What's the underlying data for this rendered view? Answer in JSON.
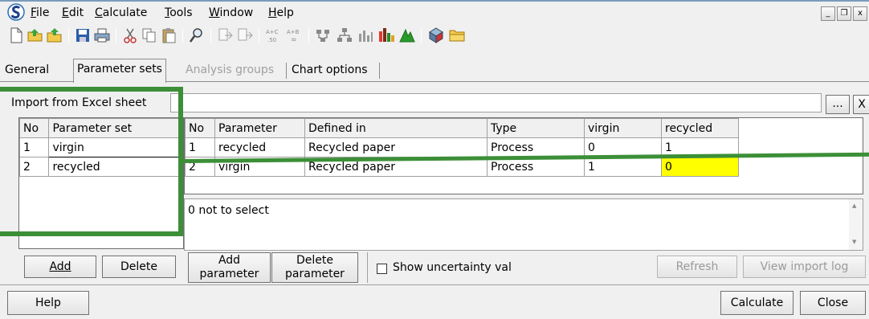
{
  "menu": {
    "file": "File",
    "edit": "Edit",
    "calculate": "Calculate",
    "tools": "Tools",
    "window": "Window",
    "help": "Help"
  },
  "mdi": {
    "minimize": "_",
    "restore": "❐",
    "close": "x"
  },
  "tabs": [
    {
      "label": "General"
    },
    {
      "label": "Parameter sets"
    },
    {
      "label": "Analysis groups"
    },
    {
      "label": "Chart options"
    }
  ],
  "import": {
    "label": "Import from Excel sheet",
    "value": "",
    "browse": "...",
    "clear": "X"
  },
  "param_sets": {
    "headers": [
      "No",
      "Parameter set"
    ],
    "rows": [
      {
        "no": "1",
        "name": "virgin"
      },
      {
        "no": "2",
        "name": "recycled"
      }
    ]
  },
  "params": {
    "headers": [
      "No",
      "Parameter",
      "Defined in",
      "Type",
      "virgin",
      "recycled"
    ],
    "rows": [
      {
        "no": "1",
        "parameter": "recycled",
        "defined_in": "Recycled paper",
        "type": "Process",
        "virgin": "0",
        "recycled": "1"
      },
      {
        "no": "2",
        "parameter": "virgin",
        "defined_in": "Recycled paper",
        "type": "Process",
        "virgin": "1",
        "recycled": "0"
      }
    ]
  },
  "note": {
    "text": "0 not to select"
  },
  "buttons": {
    "add": "Add",
    "delete": "Delete",
    "add_parameter_1": "Add",
    "add_parameter_2": "parameter",
    "delete_parameter_1": "Delete",
    "delete_parameter_2": "parameter",
    "show_uncertainty": "Show uncertainty val",
    "refresh": "Refresh",
    "view_import_log": "View import log",
    "help": "Help",
    "calculate": "Calculate",
    "close": "Close"
  },
  "colors": {
    "highlight": "#ffff00",
    "annotation": "#3c8f37",
    "logo": "#2a6fb5"
  },
  "icons": [
    "app-logo-icon",
    "new-icon",
    "open-folder-icon",
    "open-icon",
    "save-icon",
    "print-icon",
    "cut-icon",
    "copy-icon",
    "paste-icon",
    "find-icon",
    "import-icon",
    "export-icon",
    "formula-ac-icon",
    "formula-ab-icon",
    "network-icon",
    "tree-icon",
    "bar-chart-icon",
    "colored-bar-chart-icon",
    "triangle-chart-icon",
    "globe-icon",
    "folder-icon"
  ]
}
